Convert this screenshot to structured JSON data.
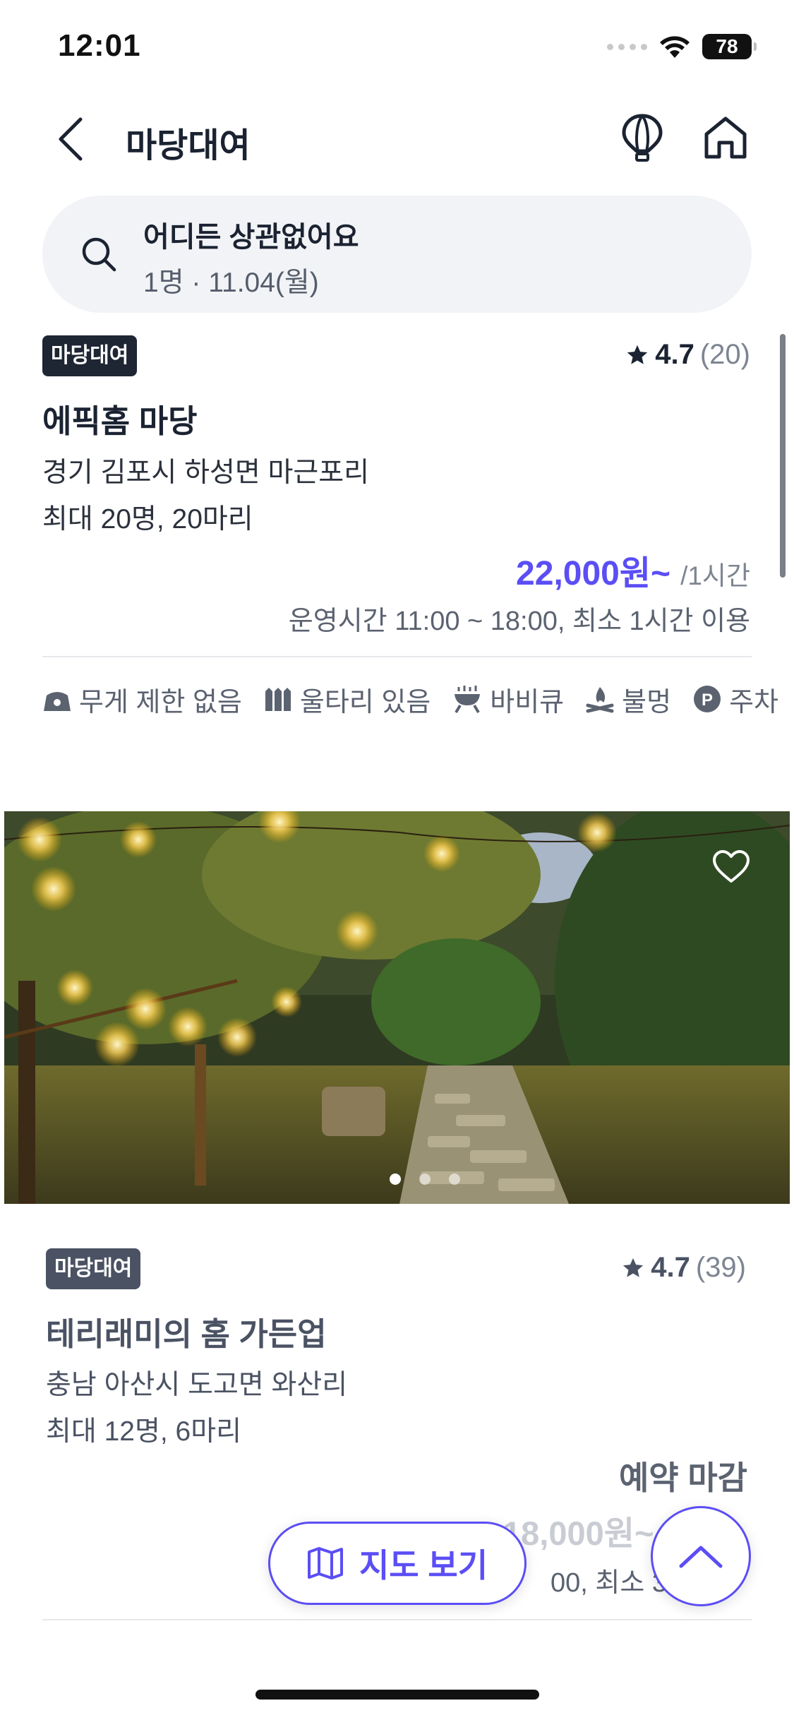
{
  "status_bar": {
    "time": "12:01",
    "battery": "78"
  },
  "header": {
    "title": "마당대여"
  },
  "search": {
    "query": "어디든 상관없어요",
    "sub": "1명 · 11.04(월)"
  },
  "listings": [
    {
      "badge": "마당대여",
      "rating": "4.7",
      "review_count": "(20)",
      "title": "에픽홈 마당",
      "address": "경기 김포시 하성면 마근포리",
      "capacity": "최대 20명, 20마리",
      "price": "22,000원~",
      "price_unit": "/1시간",
      "hours": "운영시간 11:00 ~ 18:00, 최소 1시간 이용",
      "features": [
        {
          "icon": "scale-icon",
          "label": "무게 제한 없음"
        },
        {
          "icon": "fence-icon",
          "label": "울타리 있음"
        },
        {
          "icon": "bbq-icon",
          "label": "바비큐"
        },
        {
          "icon": "campfire-icon",
          "label": "불멍"
        },
        {
          "icon": "parking-icon",
          "label": "주차"
        }
      ]
    },
    {
      "badge": "마당대여",
      "rating": "4.7",
      "review_count": "(39)",
      "title": "테리래미의 홈 가든업",
      "address": "충남 아산시 도고면 와산리",
      "capacity": "최대 12명, 6마리",
      "status": "예약 마감",
      "price": "18,000원~",
      "hours": "00, 최소 3시"
    }
  ],
  "photo": {
    "dots": 3,
    "active_dot": 0
  },
  "map_button": {
    "label": "지도 보기"
  },
  "colors": {
    "accent": "#5b4ef5",
    "dark": "#1b2332",
    "badge": "#1e2533"
  }
}
